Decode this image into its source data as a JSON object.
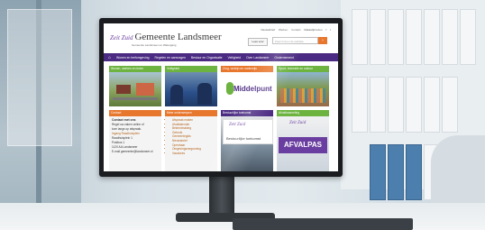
{
  "site": {
    "logo_mark": "Zeit Zuid",
    "name": "Gemeente Landsmeer",
    "tagline": "Gemeente Landsmeer en Watergang",
    "utility_links": [
      "Nieuwsbrief",
      "Werken",
      "Contact",
      "Makkelijk lezen",
      "f",
      "t"
    ],
    "readspeaker_label": "Lees voor",
    "search_placeholder": "Zoek binnen de website",
    "search_button": "›"
  },
  "nav": {
    "home": "⌂",
    "items": [
      "Wonen en leefomgeving",
      "Regelen en aanvragen",
      "Bestuur en Organisatie",
      "Veiligheid",
      "Over Landsmeer",
      "Ondernemend"
    ]
  },
  "tiles": [
    {
      "title": "Wonen, werken en leven",
      "color": "#6cb33f"
    },
    {
      "title": "Veiligheid",
      "color": "#6cb33f"
    },
    {
      "title": "Zorg, welzijn en onderwijs",
      "color": "#e8772e",
      "brand": "Middelpunt"
    },
    {
      "title": "Sport, recreatie en cultuur",
      "color": "#6cb33f"
    }
  ],
  "columns": {
    "contact": {
      "title": "Contact",
      "heading": "Contact met ons",
      "lines": [
        "Regel uw zaken online of",
        "kom langs op afspraak.",
        "Ingang Raadhuisplein",
        "",
        "Raadhuisplein 1",
        "Postbus 1",
        "1120 AA Landsmeer",
        "E-mail gemeente@landsmeer.nl"
      ]
    },
    "meer": {
      "title": "Meer onderwerpen",
      "items": [
        "Afspraak maken",
        "Afvalkalender",
        "Bekendmaking",
        "Gebruik",
        "Gemeentegids",
        "Nieuwsbrief",
        "Openbaar",
        "Omgevingsvergunning",
        "Vacatures"
      ]
    },
    "burgemeester": {
      "title": "Bestuurlijke toekomst",
      "logo": "Zeit Zuid",
      "caption": "Bestuurlijke toekomst"
    },
    "afval": {
      "title": "Afvalinzameling",
      "label": "AFVALPAS"
    }
  },
  "colors": {
    "purple": "#4a2a82",
    "orange": "#e8772e",
    "green": "#6cb33f"
  }
}
